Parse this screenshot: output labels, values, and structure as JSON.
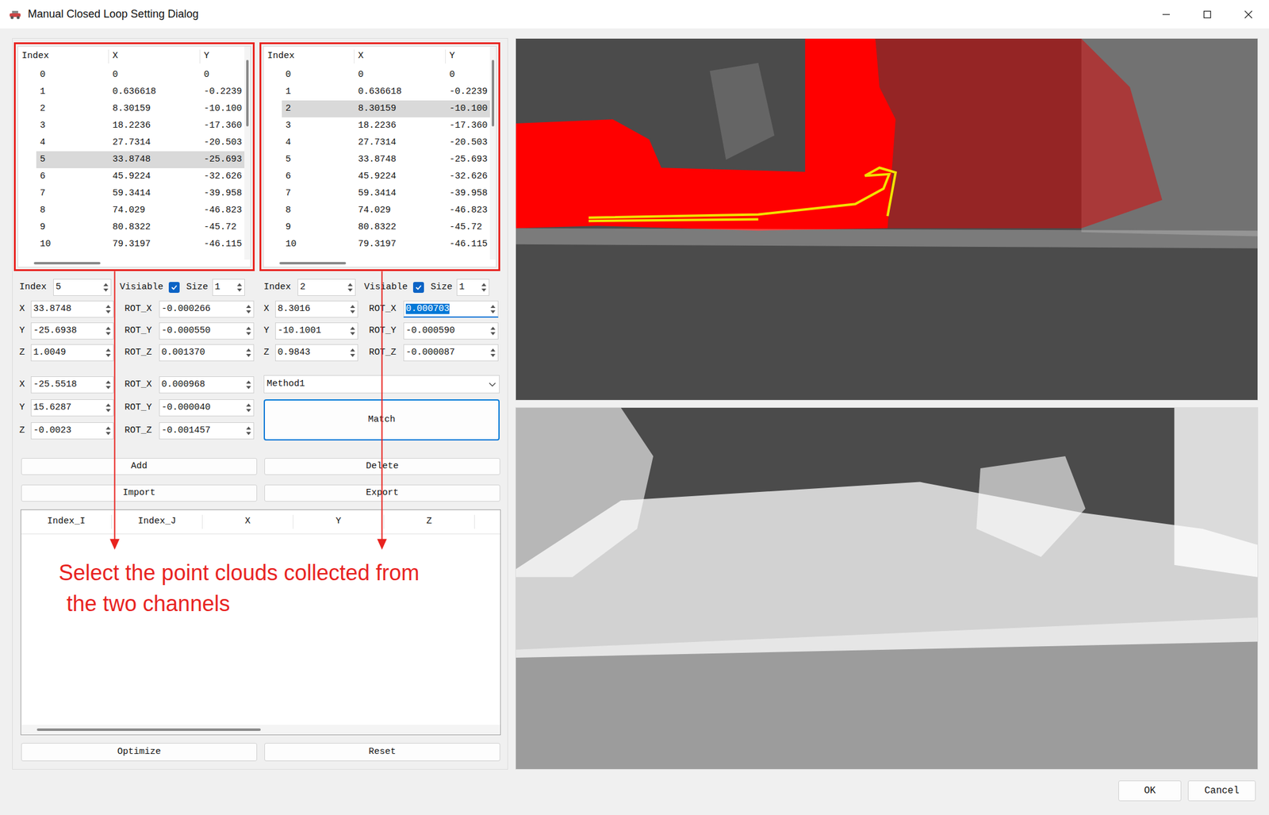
{
  "window": {
    "title": "Manual Closed Loop Setting Dialog"
  },
  "point_tables": [
    {
      "columns": [
        "Index",
        "X",
        "Y"
      ],
      "rows": [
        {
          "cells": [
            "0",
            "0",
            "0"
          ],
          "selected": false
        },
        {
          "cells": [
            "1",
            "0.636618",
            "-0.2239"
          ],
          "selected": false
        },
        {
          "cells": [
            "2",
            "8.30159",
            "-10.100"
          ],
          "selected": false
        },
        {
          "cells": [
            "3",
            "18.2236",
            "-17.360"
          ],
          "selected": false
        },
        {
          "cells": [
            "4",
            "27.7314",
            "-20.503"
          ],
          "selected": false
        },
        {
          "cells": [
            "5",
            "33.8748",
            "-25.693"
          ],
          "selected": true
        },
        {
          "cells": [
            "6",
            "45.9224",
            "-32.626"
          ],
          "selected": false
        },
        {
          "cells": [
            "7",
            "59.3414",
            "-39.958"
          ],
          "selected": false
        },
        {
          "cells": [
            "8",
            "74.029",
            "-46.823"
          ],
          "selected": false
        },
        {
          "cells": [
            "9",
            "80.8322",
            "-45.72"
          ],
          "selected": false
        },
        {
          "cells": [
            "10",
            "79.3197",
            "-46.115"
          ],
          "selected": false
        }
      ]
    },
    {
      "columns": [
        "Index",
        "X",
        "Y"
      ],
      "rows": [
        {
          "cells": [
            "0",
            "0",
            "0"
          ],
          "selected": false
        },
        {
          "cells": [
            "1",
            "0.636618",
            "-0.2239"
          ],
          "selected": false
        },
        {
          "cells": [
            "2",
            "8.30159",
            "-10.100"
          ],
          "selected": true
        },
        {
          "cells": [
            "3",
            "18.2236",
            "-17.360"
          ],
          "selected": false
        },
        {
          "cells": [
            "4",
            "27.7314",
            "-20.503"
          ],
          "selected": false
        },
        {
          "cells": [
            "5",
            "33.8748",
            "-25.693"
          ],
          "selected": false
        },
        {
          "cells": [
            "6",
            "45.9224",
            "-32.626"
          ],
          "selected": false
        },
        {
          "cells": [
            "7",
            "59.3414",
            "-39.958"
          ],
          "selected": false
        },
        {
          "cells": [
            "8",
            "74.029",
            "-46.823"
          ],
          "selected": false
        },
        {
          "cells": [
            "9",
            "80.8322",
            "-45.72"
          ],
          "selected": false
        },
        {
          "cells": [
            "10",
            "79.3197",
            "-46.115"
          ],
          "selected": false
        }
      ]
    }
  ],
  "pose_panels": [
    {
      "index_label": "Index",
      "index": "5",
      "visible_label": "Visiable",
      "visible": true,
      "size_label": "Size",
      "size": "1",
      "fields": [
        [
          {
            "label": "X",
            "value": "33.8748",
            "focused": false
          },
          {
            "label": "ROT_X",
            "value": "-0.000266",
            "focused": false
          }
        ],
        [
          {
            "label": "Y",
            "value": "-25.6938",
            "focused": false
          },
          {
            "label": "ROT_Y",
            "value": "-0.000550",
            "focused": false
          }
        ],
        [
          {
            "label": "Z",
            "value": "1.0049",
            "focused": false
          },
          {
            "label": "ROT_Z",
            "value": "0.001370",
            "focused": false
          }
        ]
      ]
    },
    {
      "index_label": "Index",
      "index": "2",
      "visible_label": "Visiable",
      "visible": true,
      "size_label": "Size",
      "size": "1",
      "fields": [
        [
          {
            "label": "X",
            "value": "8.3016",
            "focused": false
          },
          {
            "label": "ROT_X",
            "value": "0.000703",
            "focused": true
          }
        ],
        [
          {
            "label": "Y",
            "value": "-10.1001",
            "focused": false
          },
          {
            "label": "ROT_Y",
            "value": "-0.000590",
            "focused": false
          }
        ],
        [
          {
            "label": "Z",
            "value": "0.9843",
            "focused": false
          },
          {
            "label": "ROT_Z",
            "value": "-0.000087",
            "focused": false
          }
        ]
      ]
    }
  ],
  "relative_fields": [
    [
      {
        "label": "X",
        "value": "-25.5518",
        "focused": false
      },
      {
        "label": "ROT_X",
        "value": "0.000968",
        "focused": false
      }
    ],
    [
      {
        "label": "Y",
        "value": "15.6287",
        "focused": false
      },
      {
        "label": "ROT_Y",
        "value": "-0.000040",
        "focused": false
      }
    ],
    [
      {
        "label": "Z",
        "value": "-0.0023",
        "focused": false
      },
      {
        "label": "ROT_Z",
        "value": "-0.001457",
        "focused": false
      }
    ]
  ],
  "method_dropdown": {
    "value": "Method1"
  },
  "match_button": {
    "label": "Match",
    "focused": true
  },
  "action_buttons": [
    [
      "Add",
      "Delete"
    ],
    [
      "Import",
      "Export"
    ]
  ],
  "loop_table": {
    "columns": [
      "Index_I",
      "Index_J",
      "X",
      "Y",
      "Z"
    ],
    "rows": []
  },
  "annotation": {
    "lines": [
      "Select the point clouds collected from",
      "the two channels"
    ]
  },
  "bottom_buttons": [
    "Optimize",
    "Reset"
  ],
  "dialog_buttons": [
    "OK",
    "Cancel"
  ]
}
